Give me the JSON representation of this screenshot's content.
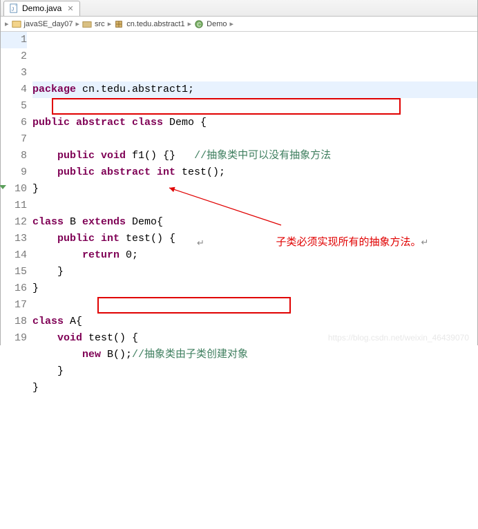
{
  "tab": {
    "filename": "Demo.java"
  },
  "breadcrumb": {
    "project": "javaSE_day07",
    "src": "src",
    "package": "cn.tedu.abstract1",
    "class": "Demo"
  },
  "lines": [
    {
      "n": 1,
      "segs": [
        {
          "t": "package",
          "c": "keyword"
        },
        {
          "t": " cn.tedu.abstract1;",
          "c": ""
        }
      ]
    },
    {
      "n": 2,
      "segs": []
    },
    {
      "n": 3,
      "segs": [
        {
          "t": "public abstract class",
          "c": "keyword"
        },
        {
          "t": " Demo {",
          "c": ""
        }
      ]
    },
    {
      "n": 4,
      "segs": []
    },
    {
      "n": 5,
      "segs": [
        {
          "t": "    ",
          "c": ""
        },
        {
          "t": "public void",
          "c": "keyword"
        },
        {
          "t": " f1() {}   ",
          "c": ""
        },
        {
          "t": "//抽象类中可以没有抽象方法",
          "c": "comment"
        }
      ]
    },
    {
      "n": 6,
      "segs": [
        {
          "t": "    ",
          "c": ""
        },
        {
          "t": "public abstract int",
          "c": "keyword"
        },
        {
          "t": " test();",
          "c": ""
        }
      ]
    },
    {
      "n": 7,
      "segs": [
        {
          "t": "}",
          "c": ""
        }
      ]
    },
    {
      "n": 8,
      "segs": []
    },
    {
      "n": 9,
      "segs": [
        {
          "t": "class",
          "c": "keyword"
        },
        {
          "t": " B ",
          "c": ""
        },
        {
          "t": "extends",
          "c": "keyword"
        },
        {
          "t": " Demo{",
          "c": ""
        }
      ]
    },
    {
      "n": 10,
      "override": true,
      "segs": [
        {
          "t": "    ",
          "c": ""
        },
        {
          "t": "public int",
          "c": "keyword"
        },
        {
          "t": " test() {",
          "c": ""
        }
      ]
    },
    {
      "n": 11,
      "segs": [
        {
          "t": "        ",
          "c": ""
        },
        {
          "t": "return",
          "c": "keyword"
        },
        {
          "t": " 0;",
          "c": ""
        }
      ]
    },
    {
      "n": 12,
      "segs": [
        {
          "t": "    }",
          "c": ""
        }
      ]
    },
    {
      "n": 13,
      "segs": [
        {
          "t": "}",
          "c": ""
        }
      ]
    },
    {
      "n": 14,
      "segs": []
    },
    {
      "n": 15,
      "segs": [
        {
          "t": "class",
          "c": "keyword"
        },
        {
          "t": " A{",
          "c": ""
        }
      ]
    },
    {
      "n": 16,
      "segs": [
        {
          "t": "    ",
          "c": ""
        },
        {
          "t": "void",
          "c": "keyword"
        },
        {
          "t": " test() {",
          "c": ""
        }
      ]
    },
    {
      "n": 17,
      "segs": [
        {
          "t": "        ",
          "c": ""
        },
        {
          "t": "new",
          "c": "keyword"
        },
        {
          "t": " B();",
          "c": ""
        },
        {
          "t": "//抽象类由子类创建对象",
          "c": "comment"
        }
      ]
    },
    {
      "n": 18,
      "segs": [
        {
          "t": "    }",
          "c": ""
        }
      ]
    },
    {
      "n": 19,
      "segs": [
        {
          "t": "}",
          "c": ""
        }
      ]
    }
  ],
  "annotation": {
    "side_text": "子类必须实现所有的抽象方法。",
    "return_mark1": "↵",
    "return_mark2": "↵"
  },
  "watermark": "https://blog.csdn.net/weixin_46439070"
}
